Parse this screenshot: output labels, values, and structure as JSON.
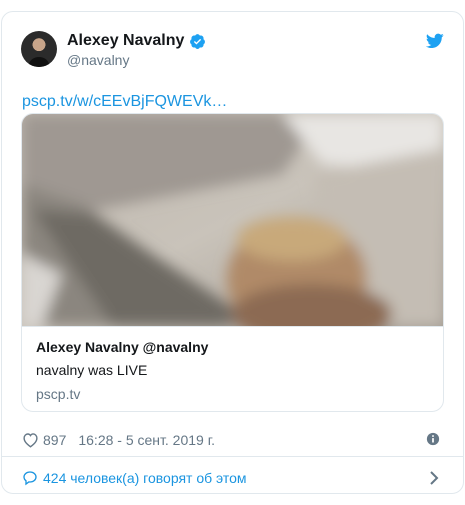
{
  "tweet": {
    "author_name": "Alexey Navalny",
    "author_handle": "@navalny",
    "link_text": "pscp.tv/w/cEEvBjFQWEVk…",
    "card": {
      "title": "Alexey Navalny @navalny",
      "description": "navalny was LIVE",
      "domain": "pscp.tv"
    },
    "likes": "897",
    "timestamp": "16:28 - 5 сент. 2019 г.",
    "footer_text": "424 человек(а) говорят об этом"
  },
  "colors": {
    "link": "#1b95e0",
    "muted": "#657786",
    "border": "#e1e8ed"
  },
  "icons": [
    "verified-badge-icon",
    "twitter-bird-icon",
    "heart-icon",
    "info-icon",
    "comment-bubble-icon",
    "chevron-right-icon"
  ]
}
